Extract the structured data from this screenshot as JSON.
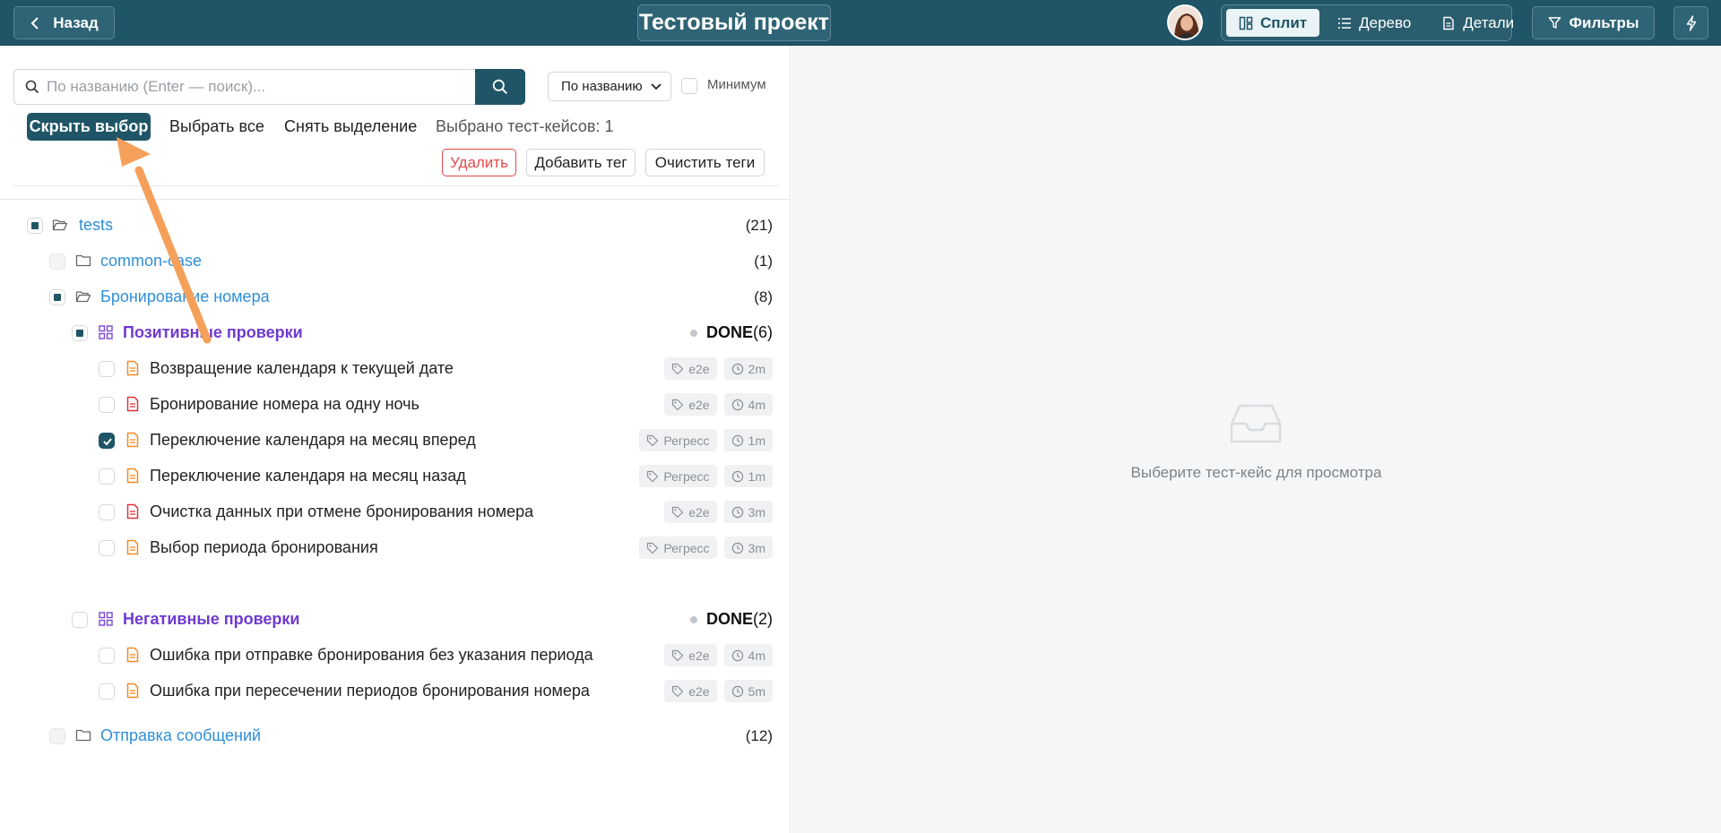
{
  "header": {
    "back_label": "Назад",
    "project_title": "Тестовый проект",
    "views": [
      {
        "label": "Сплит",
        "active": true,
        "icon": "split-icon"
      },
      {
        "label": "Дерево",
        "active": false,
        "icon": "tree-list-icon"
      },
      {
        "label": "Детали",
        "active": false,
        "icon": "document-icon"
      }
    ],
    "filters_label": "Фильтры"
  },
  "search": {
    "placeholder": "По названию (Enter — поиск)...",
    "value": ""
  },
  "sort": {
    "selected": "По названию"
  },
  "minimum": {
    "label": "Минимум",
    "checked": false
  },
  "selection_toolbar": {
    "hide_selection": "Скрыть выбор",
    "select_all": "Выбрать все",
    "deselect": "Снять выделение",
    "selected_count": "Выбрано тест-кейсов: 1",
    "delete": "Удалить",
    "add_tag": "Добавить тег",
    "clear_tags": "Очистить теги"
  },
  "tree": {
    "root": {
      "label": "tests",
      "count": "(21)"
    },
    "common": {
      "label": "common-case",
      "count": "(1)"
    },
    "booking": {
      "label": "Бронирование номера",
      "count": "(8)"
    },
    "positive": {
      "label": "Позитивные проверки",
      "status": "DONE",
      "count": "(6)"
    },
    "positive_cases": [
      {
        "label": "Возвращение календаря к текущей дате",
        "tag": "e2e",
        "time": "2m",
        "checked": false,
        "priority": "medium"
      },
      {
        "label": "Бронирование номера на одну ночь",
        "tag": "e2e",
        "time": "4m",
        "checked": false,
        "priority": "high"
      },
      {
        "label": "Переключение календаря на месяц вперед",
        "tag": "Регресс",
        "time": "1m",
        "checked": true,
        "priority": "medium"
      },
      {
        "label": "Переключение календаря на месяц назад",
        "tag": "Регресс",
        "time": "1m",
        "checked": false,
        "priority": "medium"
      },
      {
        "label": "Очистка данных при отмене бронирования номера",
        "tag": "e2e",
        "time": "3m",
        "checked": false,
        "priority": "high"
      },
      {
        "label": "Выбор периода бронирования",
        "tag": "Регресс",
        "time": "3m",
        "checked": false,
        "priority": "medium"
      }
    ],
    "negative": {
      "label": "Негативные проверки",
      "status": "DONE",
      "count": "(2)"
    },
    "negative_cases": [
      {
        "label": "Ошибка при отправке бронирования без указания периода",
        "tag": "e2e",
        "time": "4m",
        "checked": false,
        "priority": "medium"
      },
      {
        "label": "Ошибка при пересечении периодов бронирования номера",
        "tag": "e2e",
        "time": "5m",
        "checked": false,
        "priority": "medium"
      }
    ],
    "messages": {
      "label": "Отправка сообщений",
      "count": "(12)"
    }
  },
  "detail_panel": {
    "empty_text": "Выберите тест-кейс для просмотра"
  },
  "colors": {
    "header_bg": "#1f5566",
    "folder_link": "#2f8fd8",
    "suite_label": "#6f3ad1",
    "danger": "#e5484d",
    "doc_icon_orange": "#f08a24",
    "doc_icon_red": "#d9363e",
    "annotation_arrow": "#f5a05a"
  }
}
